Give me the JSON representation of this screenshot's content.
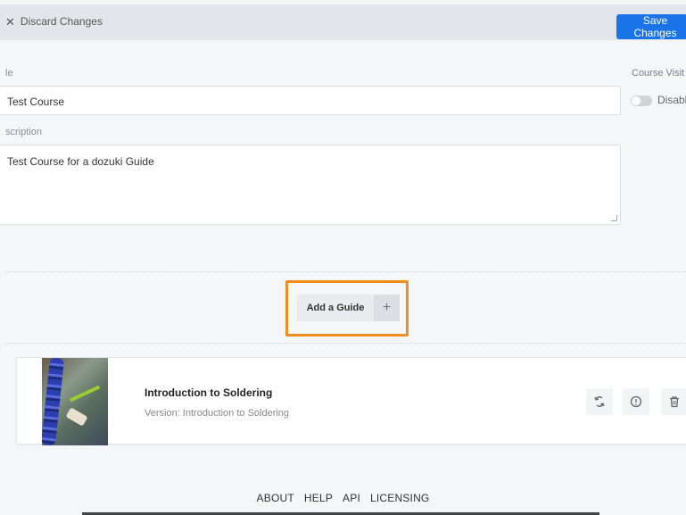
{
  "topbar": {
    "discard_label": "Discard Changes",
    "save_label": "Save Changes"
  },
  "form": {
    "title_label": "le",
    "title_value": "Test Course",
    "description_label": "scription",
    "description_value": "Test Course for a dozuki Guide",
    "visibility_label": "Course Visit",
    "visibility_state": "Disabl"
  },
  "add_guide": {
    "label": "Add a Guide",
    "plus": "+"
  },
  "guide_card": {
    "title": "Introduction to Soldering",
    "version": "Version: Introduction to Soldering",
    "actions": [
      "swap-icon",
      "info-icon",
      "trash-icon"
    ]
  },
  "footer": {
    "links": [
      "ABOUT",
      "HELP",
      "API",
      "LICENSING"
    ]
  },
  "colors": {
    "accent": "#1a73e8",
    "highlight": "#f28c1a"
  }
}
